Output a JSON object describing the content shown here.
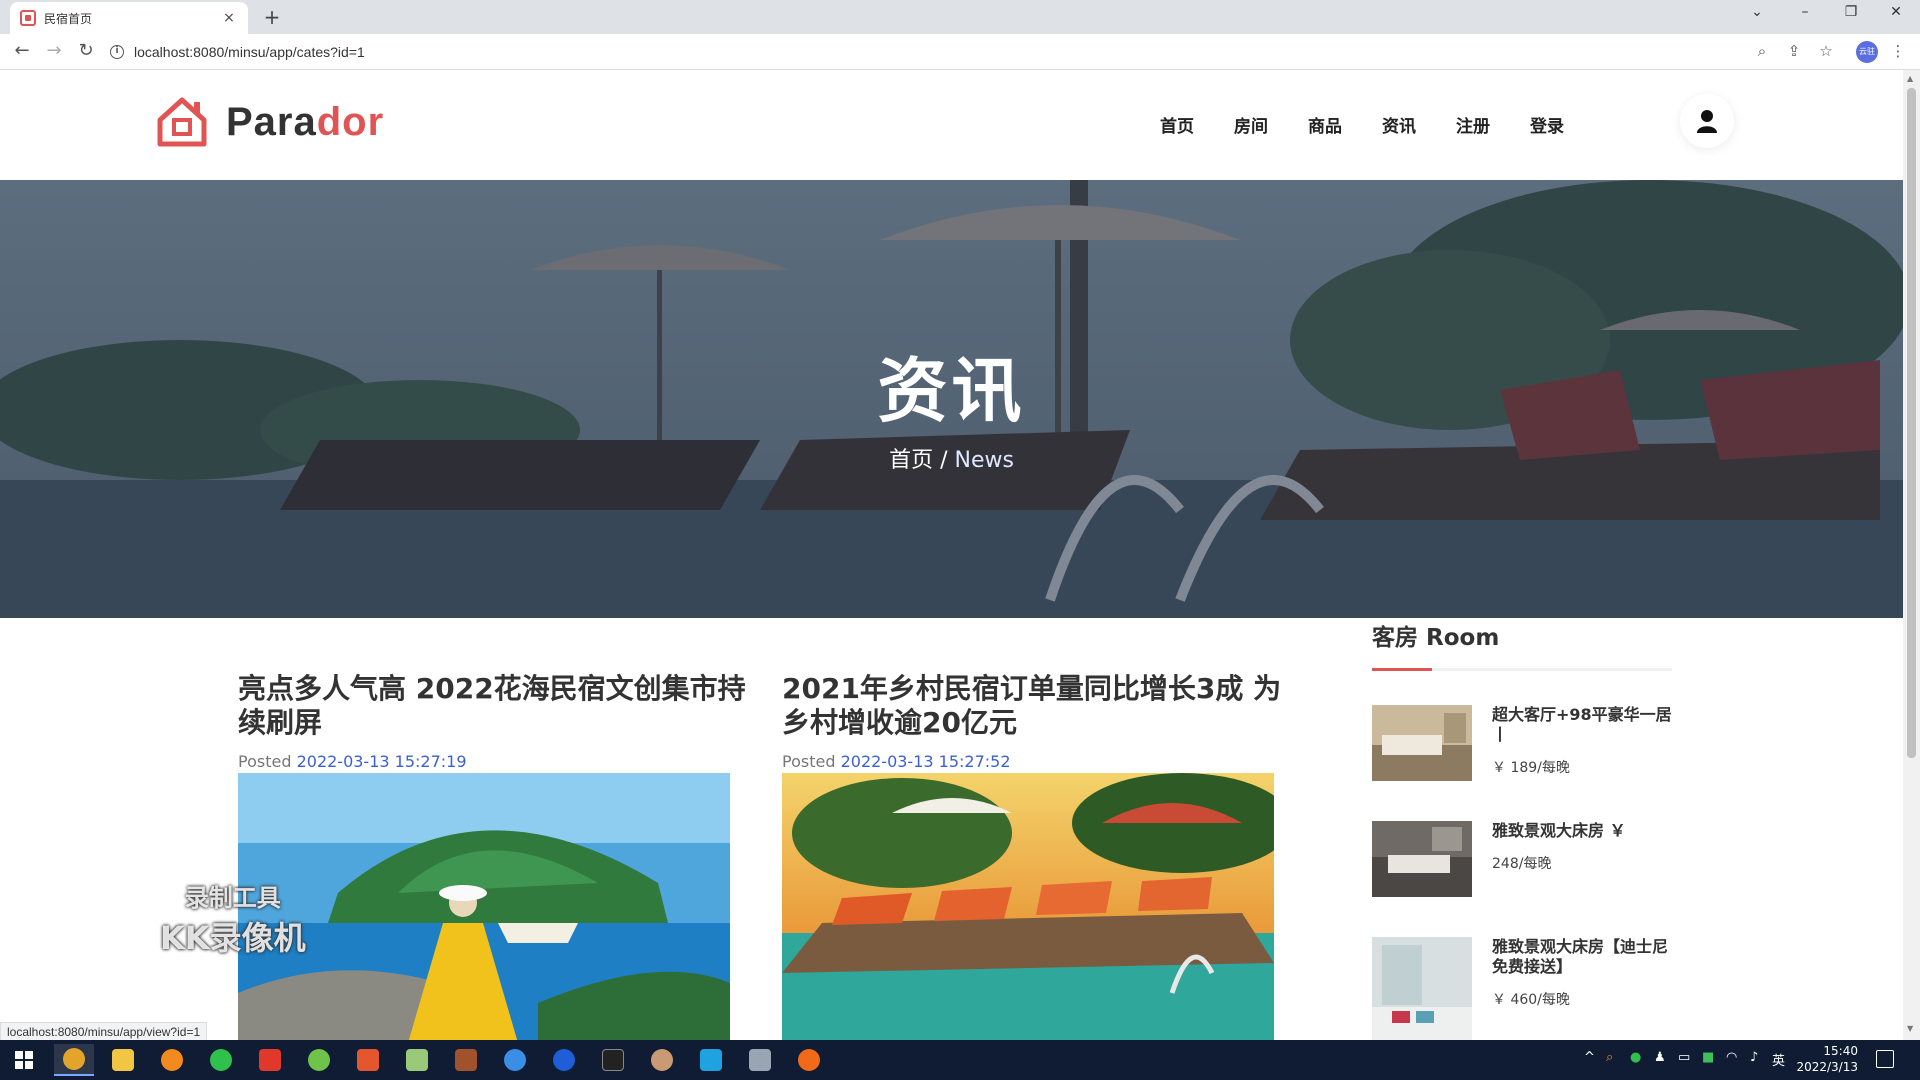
{
  "browser": {
    "tab_title": "民宿首页",
    "tab_close": "×",
    "new_tab": "+",
    "url": "localhost:8080/minsu/app/cates?id=1",
    "status_url": "localhost:8080/minsu/app/view?id=1",
    "profile_label": "云驻"
  },
  "site": {
    "brand_prefix": "Para",
    "brand_suffix": "dor",
    "nav": [
      "首页",
      "房间",
      "商品",
      "资讯",
      "注册",
      "登录"
    ],
    "hero_title": "资讯",
    "breadcrumb_home": "首页",
    "breadcrumb_sep": " / ",
    "breadcrumb_current": "News"
  },
  "posts": [
    {
      "title": "亮点多人气高 2022花海民宿文创集市持续刷屏",
      "posted_label": "Posted",
      "date": "2022-03-13 15:27:19"
    },
    {
      "title": "2021年乡村民宿订单量同比增长3成 为乡村增收逾20亿元",
      "posted_label": "Posted",
      "date": "2022-03-13 15:27:52"
    }
  ],
  "sidebar": {
    "title": "客房 Room",
    "rooms": [
      {
        "name": "超大客厅+98平豪华一居丨",
        "price": "￥ 189/每晚"
      },
      {
        "name": "雅致景观大床房 ￥",
        "price": "248/每晚"
      },
      {
        "name": "雅致景观大床房【迪士尼免费接送】",
        "price": "￥ 460/每晚"
      }
    ]
  },
  "watermark": {
    "line1": "录制工具",
    "line2": "KK录像机"
  },
  "taskbar": {
    "time": "15:40",
    "date": "2022/3/13",
    "ime": "英"
  },
  "colors": {
    "accent": "#e05454",
    "link": "#3b5fd6",
    "taskbar": "#0f1c33"
  }
}
